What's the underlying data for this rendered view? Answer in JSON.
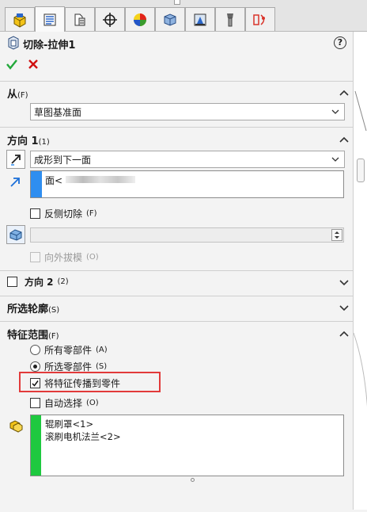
{
  "tabs": [
    {
      "name": "featuremanager-tab-icon"
    },
    {
      "name": "propertymanager-tab-icon"
    },
    {
      "name": "configuration-manager-tab-icon"
    },
    {
      "name": "dimxpert-tab-icon"
    },
    {
      "name": "display-manager-tab-icon"
    },
    {
      "name": "cam-tab-icon"
    },
    {
      "name": "simulation-tab-icon"
    },
    {
      "name": "tool-tab-icon"
    },
    {
      "name": "render-tab-icon"
    }
  ],
  "feature": {
    "title": "切除-拉伸1"
  },
  "from_section": {
    "label": "从",
    "shortcut": "(F)",
    "start_value": "草图基准面"
  },
  "direction1": {
    "label": "方向 1",
    "shortcut": "(1)",
    "end_condition": "成形到下一面",
    "face_item": "面<",
    "flip_label": "反侧切除",
    "flip_shortcut": "(F)",
    "draft_label": "向外拔模",
    "draft_shortcut": "(O)"
  },
  "direction2": {
    "label": "方向 2",
    "shortcut": "(2)"
  },
  "selected_contours": {
    "label": "所选轮廓",
    "shortcut": "(S)"
  },
  "feature_scope": {
    "label": "特征范围",
    "shortcut": "(F)",
    "all_components": "所有零部件",
    "all_shortcut": "(A)",
    "selected_components": "所选零部件",
    "selected_shortcut": "(S)",
    "propagate": "将特征传播到零件",
    "auto_select": "自动选择",
    "auto_shortcut": "(O)",
    "components": [
      "辊刷罩<1>",
      "滚刷电机法兰<2>"
    ]
  },
  "colors": {
    "accent_blue": "#2f8ef0",
    "accent_green": "#1ec93f",
    "highlight_red": "#e23a3a",
    "ok_green": "#22a83a",
    "cancel_red": "#d01010"
  }
}
